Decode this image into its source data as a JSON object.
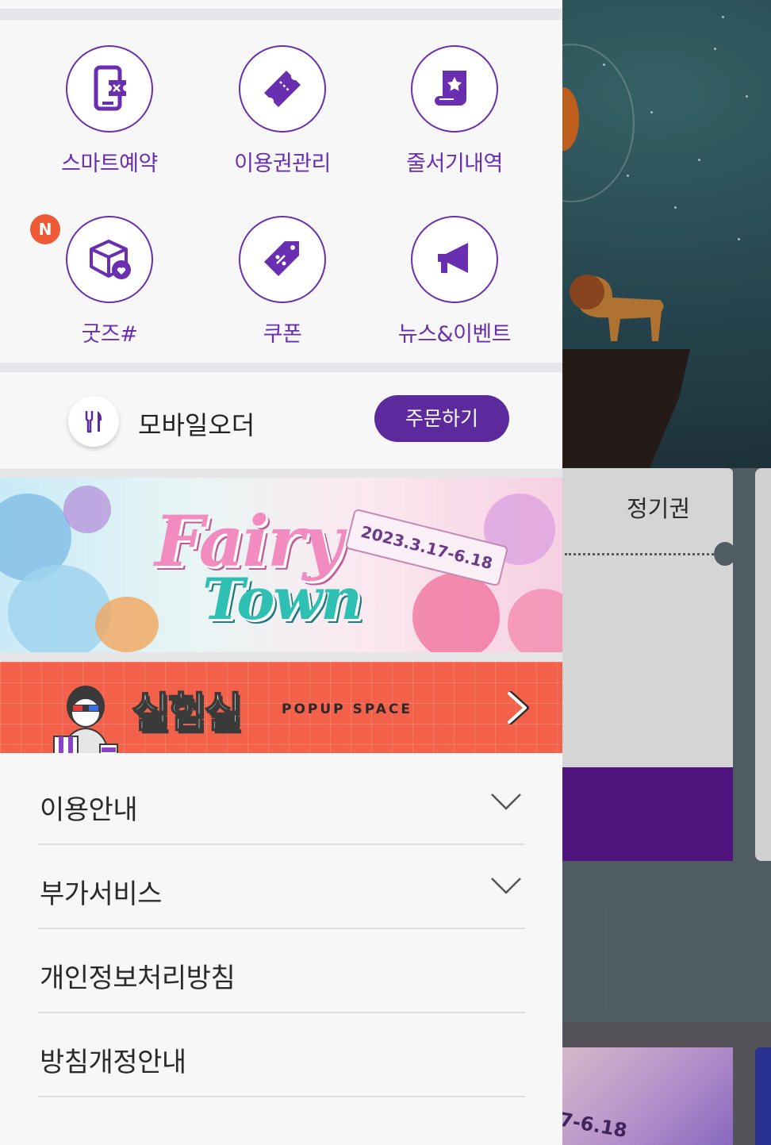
{
  "quick_menu": [
    {
      "label": "스마트예약",
      "icon": "smart-reservation-icon"
    },
    {
      "label": "이용권관리",
      "icon": "ticket-icon"
    },
    {
      "label": "줄서기내역",
      "icon": "queue-history-icon"
    },
    {
      "label": "굿즈#",
      "icon": "goods-box-icon",
      "badge": "N"
    },
    {
      "label": "쿠폰",
      "icon": "coupon-tag-icon"
    },
    {
      "label": "뉴스&이벤트",
      "icon": "megaphone-icon"
    }
  ],
  "mobile_order": {
    "label": "모바일오더",
    "icon": "fork-knife-icon",
    "button": "주문하기"
  },
  "banner_fairy": {
    "title_line1": "Fairy",
    "title_line2": "Town",
    "date": "2023.3.17-6.18"
  },
  "banner_popup": {
    "title": "실험실",
    "subtitle": "POPUP SPACE"
  },
  "menu": [
    {
      "label": "이용안내",
      "expandable": true
    },
    {
      "label": "부가서비스",
      "expandable": true
    },
    {
      "label": "개인정보처리방침",
      "expandable": false
    },
    {
      "label": "방침개정안내",
      "expandable": false
    }
  ],
  "background": {
    "season_card_label": "정기권",
    "bottom_card_text": "7-6.18"
  },
  "colors": {
    "accent_purple": "#6a2fb1",
    "button_purple": "#5c2a9d",
    "popup_orange": "#f4614a",
    "badge_orange": "#ee5a36"
  }
}
